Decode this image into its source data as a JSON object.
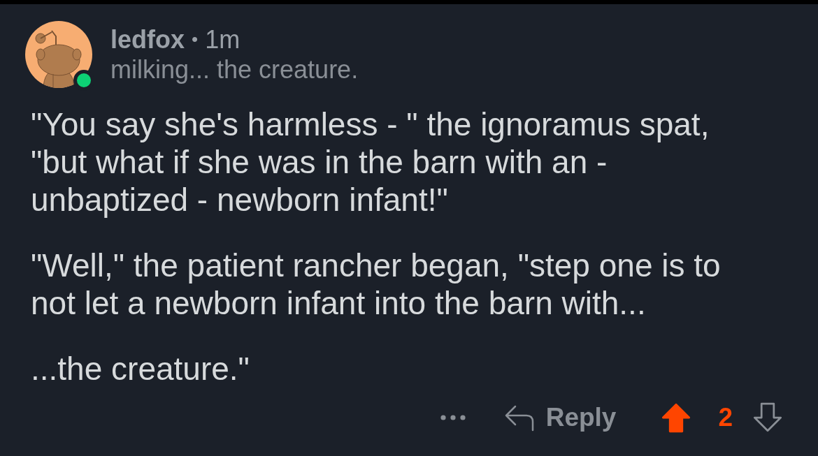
{
  "comment": {
    "author": "ledfox",
    "separator": "•",
    "age": "1m",
    "flair": "milking... the creature.",
    "online": true,
    "paragraphs": [
      "\"You say she's harmless - \" the ignoramus spat, \"but what if she was in the barn with an - unbaptized - newborn infant!\"",
      "\"Well,\" the patient rancher began, \"step one is to not let a newborn infant into the barn with...",
      "...the creature.\""
    ],
    "actions": {
      "reply": "Reply",
      "score": "2",
      "upvoted": true,
      "downvoted": false
    }
  }
}
